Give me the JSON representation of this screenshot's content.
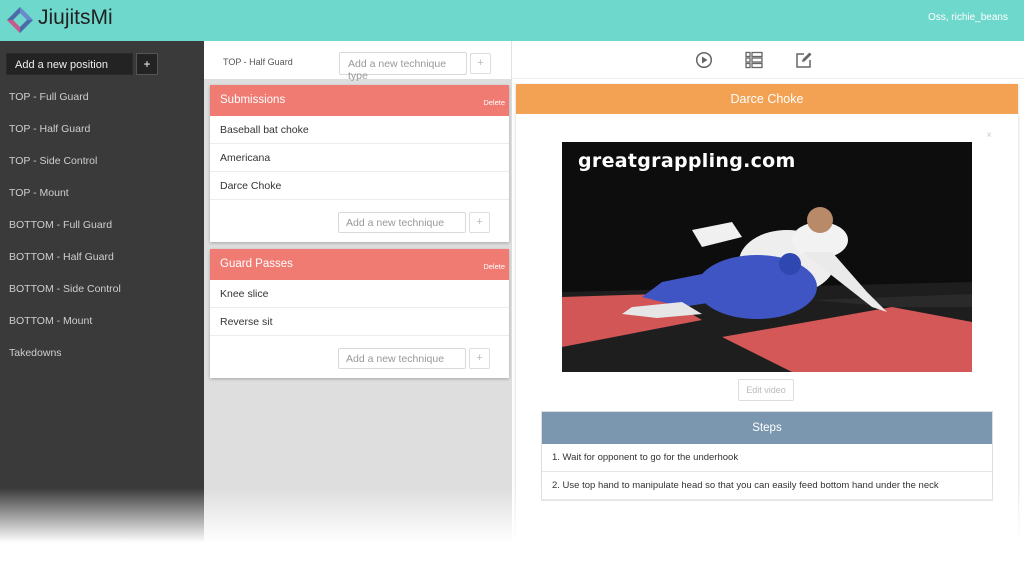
{
  "header": {
    "brand": "JiujitsMi",
    "user": "Oss, richie_beans",
    "colors": {
      "bar": "#6fd8cc"
    }
  },
  "sidebar": {
    "add_placeholder": "Add a new position",
    "add_button": "+",
    "positions": [
      {
        "label": "TOP - Full Guard"
      },
      {
        "label": "TOP - Half Guard"
      },
      {
        "label": "TOP - Side Control"
      },
      {
        "label": "TOP - Mount"
      },
      {
        "label": "BOTTOM - Full Guard"
      },
      {
        "label": "BOTTOM - Half Guard"
      },
      {
        "label": "BOTTOM - Side Control"
      },
      {
        "label": "BOTTOM - Mount"
      },
      {
        "label": "Takedowns"
      }
    ]
  },
  "middle": {
    "current_position": "TOP - Half Guard",
    "type_placeholder": "Add a new technique type",
    "plus": "+",
    "groups": [
      {
        "title": "Submissions",
        "delete_label": "Delete",
        "techniques": [
          {
            "label": "Baseball bat choke"
          },
          {
            "label": "Americana"
          },
          {
            "label": "Darce Choke"
          }
        ],
        "add_placeholder": "Add a new technique"
      },
      {
        "title": "Guard Passes",
        "delete_label": "Delete",
        "techniques": [
          {
            "label": "Knee slice"
          },
          {
            "label": "Reverse sit"
          }
        ],
        "add_placeholder": "Add a new technique"
      }
    ],
    "colors": {
      "group_header": "#ef7b73"
    }
  },
  "toolbar": {
    "icons": [
      "play-icon",
      "list-icon",
      "edit-icon"
    ]
  },
  "detail": {
    "title": "Darce Choke",
    "close": "×",
    "video_watermark": "greatgrappling.com",
    "edit_video_label": "Edit video",
    "steps_title": "Steps",
    "steps": [
      {
        "text": "1. Wait for opponent to go for the underhook"
      },
      {
        "text": "2. Use top hand to manipulate head so that you can easily feed bottom hand under the neck"
      }
    ],
    "colors": {
      "header": "#f3a253",
      "steps_header": "#7b97b0"
    }
  }
}
